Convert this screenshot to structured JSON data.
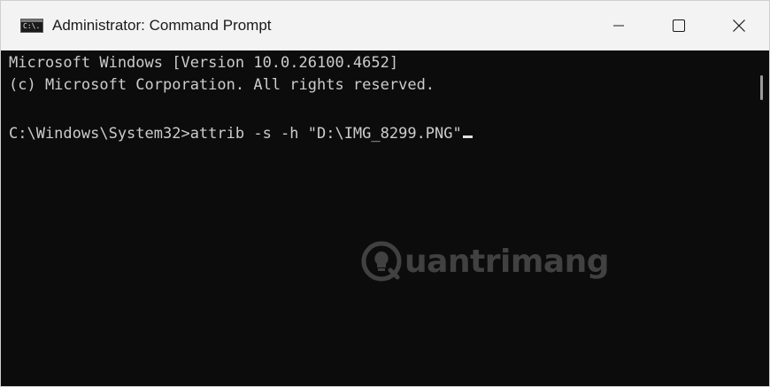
{
  "window": {
    "title": "Administrator: Command Prompt",
    "icon_glyph": "C:\\."
  },
  "controls": {
    "minimize_icon": "minimize-icon",
    "maximize_icon": "maximize-icon",
    "close_icon": "close-icon"
  },
  "console": {
    "lines": [
      "Microsoft Windows [Version 10.0.26100.4652]",
      "(c) Microsoft Corporation. All rights reserved.",
      "",
      "C:\\Windows\\System32>attrib -s -h \"D:\\IMG_8299.PNG\""
    ]
  },
  "watermark": {
    "text": "uantrimang"
  },
  "colors": {
    "console_bg": "#0c0c0c",
    "console_text": "#cccccc",
    "titlebar_bg": "#f3f3f3"
  }
}
